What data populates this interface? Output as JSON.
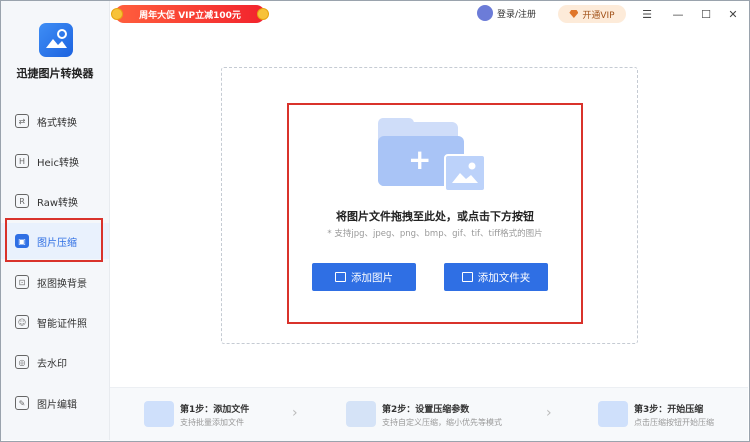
{
  "app": {
    "title": "迅捷图片转换器"
  },
  "topbar": {
    "promo": "周年大促 VIP立减100元",
    "login": "登录/注册",
    "vip": "开通VIP",
    "menu_icon": "☰",
    "min_icon": "—",
    "max_icon": "☐",
    "close_icon": "✕"
  },
  "sidebar": {
    "items": [
      {
        "label": "格式转换",
        "glyph": "⇄"
      },
      {
        "label": "Heic转换",
        "glyph": "H"
      },
      {
        "label": "Raw转换",
        "glyph": "R"
      },
      {
        "label": "图片压缩",
        "glyph": "▣"
      },
      {
        "label": "抠图换背景",
        "glyph": "⊡"
      },
      {
        "label": "智能证件照",
        "glyph": "☺"
      },
      {
        "label": "去水印",
        "glyph": "◎"
      },
      {
        "label": "图片编辑",
        "glyph": "✎"
      }
    ],
    "active_index": 3
  },
  "main": {
    "drop_title": "将图片文件拖拽至此处，或点击下方按钮",
    "drop_hint": "* 支持jpg、jpeg、png、bmp、gif、tif、tiff格式的图片",
    "add_image": "添加图片",
    "add_folder": "添加文件夹"
  },
  "steps": [
    {
      "title": "第1步：添加文件",
      "desc": "支持批量添加文件"
    },
    {
      "title": "第2步：设置压缩参数",
      "desc": "支持自定义压缩，缩小优先等模式"
    },
    {
      "title": "第3步：开始压缩",
      "desc": "点击压缩按钮开始压缩"
    }
  ],
  "colors": {
    "accent": "#2f6fe4",
    "highlight": "#d9322b",
    "promo": "#f2232d"
  }
}
